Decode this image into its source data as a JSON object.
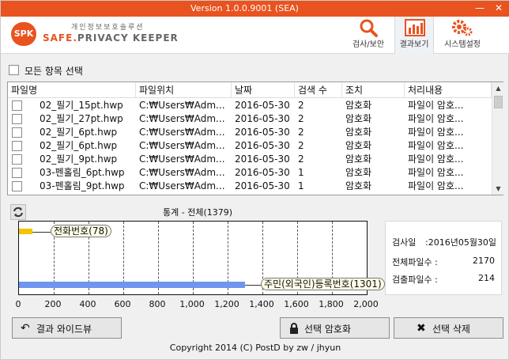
{
  "window": {
    "title": "Version 1.0.0.9001 (SEA)",
    "minimize": "—",
    "close": "✕"
  },
  "logo": {
    "mark": "SPK",
    "subtitle": "개인정보보호솔루션",
    "name_a": "SAFE.",
    "name_b": "PRIVACY",
    "name_c": " KEEPER"
  },
  "nav": [
    {
      "label": "검사/보안",
      "icon": "magnifier-icon"
    },
    {
      "label": "결과보기",
      "icon": "bar-chart-icon"
    },
    {
      "label": "시스템설정",
      "icon": "gears-icon"
    }
  ],
  "select_all": {
    "label": "모든 항목 선택"
  },
  "table": {
    "columns": [
      "파일명",
      "파일위치",
      "날짜",
      "검색 수",
      "조치",
      "처리내용"
    ],
    "rows": [
      [
        "02_필기_15pt.hwp",
        "C:₩Users₩Adm...",
        "2016-05-30",
        "2",
        "암호화",
        "파일이 암호..."
      ],
      [
        "02_필기_27pt.hwp",
        "C:₩Users₩Adm...",
        "2016-05-30",
        "2",
        "암호화",
        "파일이 암호..."
      ],
      [
        "02_필기_6pt.hwp",
        "C:₩Users₩Adm...",
        "2016-05-30",
        "2",
        "암호화",
        "파일이 암호..."
      ],
      [
        "02_필기_6pt.hwp",
        "C:₩Users₩Adm...",
        "2016-05-30",
        "2",
        "암호화",
        "파일이 암호..."
      ],
      [
        "02_필기_9pt.hwp",
        "C:₩Users₩Adm...",
        "2016-05-30",
        "2",
        "암호화",
        "파일이 암호..."
      ],
      [
        "03-펜홀림_6pt.hwp",
        "C:₩Users₩Adm...",
        "2016-05-30",
        "1",
        "암호화",
        "파일이 암호..."
      ],
      [
        "03-펜홀림_9pt.hwp",
        "C:₩Users₩Adm...",
        "2016-05-30",
        "1",
        "암호화",
        "파일이 암호..."
      ]
    ]
  },
  "stats_title": "통계 - 전체(1379)",
  "chart_data": {
    "type": "bar",
    "orientation": "horizontal",
    "categories": [
      "전화번호",
      "주민(외국인)등록번호"
    ],
    "values": [
      78,
      1301
    ],
    "category_labels": [
      "전화번호(78)",
      "주민(외국인)등록번호(1301)"
    ],
    "colors": [
      "#f5c400",
      "#6f96ee"
    ],
    "xlim": [
      0,
      2000
    ],
    "xticks": [
      "0",
      "200",
      "400",
      "600",
      "800",
      "1,000",
      "1,200",
      "1,400",
      "1,600",
      "1,800",
      "2,000"
    ],
    "grid": true
  },
  "stats": [
    {
      "label": "검사일",
      "value": ":2016년05월30일"
    },
    {
      "label": "전체파일수 :",
      "value": "2170"
    },
    {
      "label": "검출파일수 :",
      "value": "214"
    }
  ],
  "buttons": {
    "wide_view": "결과 와이드뷰",
    "encrypt": "선택 암호화",
    "delete": "선택 삭제"
  },
  "footer": "Copyright 2014 (C) PostD by zw / jhyun",
  "accent": "#e8531f"
}
